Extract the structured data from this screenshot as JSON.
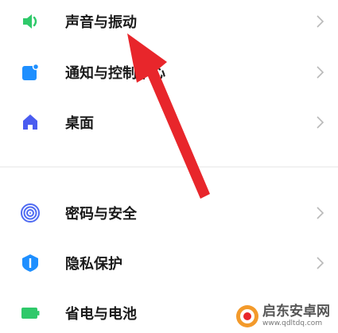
{
  "settings_list": {
    "items": [
      {
        "label": "声音与振动",
        "icon": "speaker-icon",
        "color": "#2fc96a"
      },
      {
        "label": "通知与控制中心",
        "icon": "notification-icon",
        "color": "#1e8fff"
      },
      {
        "label": "桌面",
        "icon": "home-icon",
        "color": "#4a5cf0"
      },
      {
        "label": "密码与安全",
        "icon": "fingerprint-icon",
        "color": "#4f6bf2"
      },
      {
        "label": "隐私保护",
        "icon": "privacy-shield-icon",
        "color": "#1e8fff"
      },
      {
        "label": "省电与电池",
        "icon": "battery-icon",
        "color": "#2fc96a"
      }
    ]
  },
  "watermark": {
    "name": "启东安卓网",
    "url": "www.qdltdq.com"
  },
  "annotation": {
    "arrow_color": "#e8262b"
  }
}
